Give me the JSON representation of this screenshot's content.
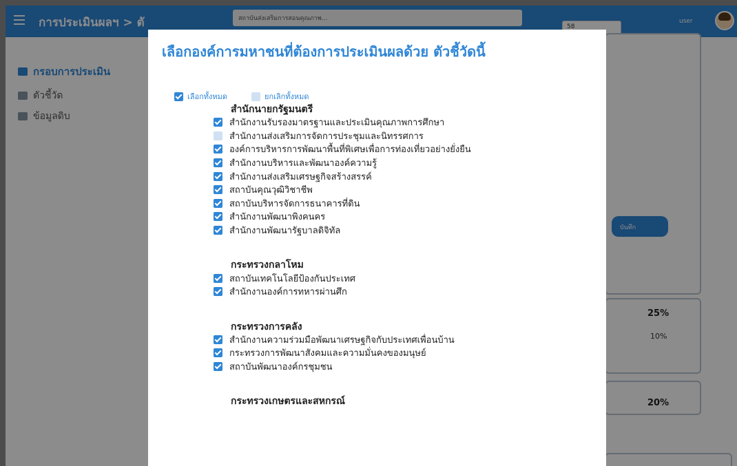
{
  "app": {
    "title": "การประเมินผลฯ",
    "breadcrumb_sep": "> ตั",
    "top_select_text": "สถาบันส่งเสริมการสอนคุณภาพ...",
    "top_field_value": "58",
    "user_label": "user",
    "sidebar": [
      {
        "label": "กรอบการประเมิน",
        "icon": "grid-icon"
      },
      {
        "label": "ตัวชี้วัด",
        "icon": "chart-icon"
      },
      {
        "label": "ข้อมูลดิบ",
        "icon": "data-icon"
      }
    ],
    "bg_button_label": "บันทึก",
    "bg_percent_1": "25%",
    "bg_percent_1_sub": "10%",
    "bg_percent_2": "20%"
  },
  "modal": {
    "title": "เลือกองค์การมหาชนที่ต้องการประเมินผลด้วย ตัวชี้วัดนี้",
    "select_all_label": "เลือกทั้งหมด",
    "deselect_all_label": "ยกเลิกทั้งหมด",
    "groups": [
      {
        "name": "สำนักนายกรัฐมนตรี",
        "items": [
          {
            "label": "สำนักงานรับรองมาตรฐานและประเมินคุณภาพการศึกษา",
            "checked": true
          },
          {
            "label": "สำนักงานส่งเสริมการจัดการประชุมและนิทรรศการ",
            "checked": false
          },
          {
            "label": "องค์การบริหารการพัฒนาพื้นที่พิเศษเพื่อการท่องเที่ยวอย่างยั่งยืน",
            "checked": true
          },
          {
            "label": "สำนักงานบริหารและพัฒนาองค์ความรู้",
            "checked": true
          },
          {
            "label": "สำนักงานส่งเสริมเศรษฐกิจสร้างสรรค์",
            "checked": true
          },
          {
            "label": "สถาบันคุณวุฒิวิชาชีพ",
            "checked": true
          },
          {
            "label": "สถาบันบริหารจัดการธนาคารที่ดิน",
            "checked": true
          },
          {
            "label": "สำนักงานพัฒนาพิงคนคร",
            "checked": true
          },
          {
            "label": "สำนักงานพัฒนารัฐบาลดิจิทัล",
            "checked": true
          }
        ]
      },
      {
        "name": "กระทรวงกลาโหม",
        "items": [
          {
            "label": "สถาบันเทคโนโลยีป้องกันประเทศ",
            "checked": true
          },
          {
            "label": "สำนักงานองค์การทหารผ่านศึก",
            "checked": true
          }
        ]
      },
      {
        "name": "กระทรวงการคลัง",
        "items": [
          {
            "label": "สำนักงานความร่วมมือพัฒนาเศรษฐกิจกับประเทศเพื่อนบ้าน",
            "checked": true
          },
          {
            "label": "กระทรวงการพัฒนาสังคมและความมั่นคงของมนุษย์",
            "checked": true
          },
          {
            "label": "สถาบันพัฒนาองค์กรชุมชน",
            "checked": true
          }
        ]
      },
      {
        "name": "กระทรวงเกษตรและสหกรณ์",
        "items": []
      }
    ]
  },
  "colors": {
    "accent": "#2f86d6",
    "checkbox_off": "#cfe1f3",
    "overlay": "#000000"
  }
}
